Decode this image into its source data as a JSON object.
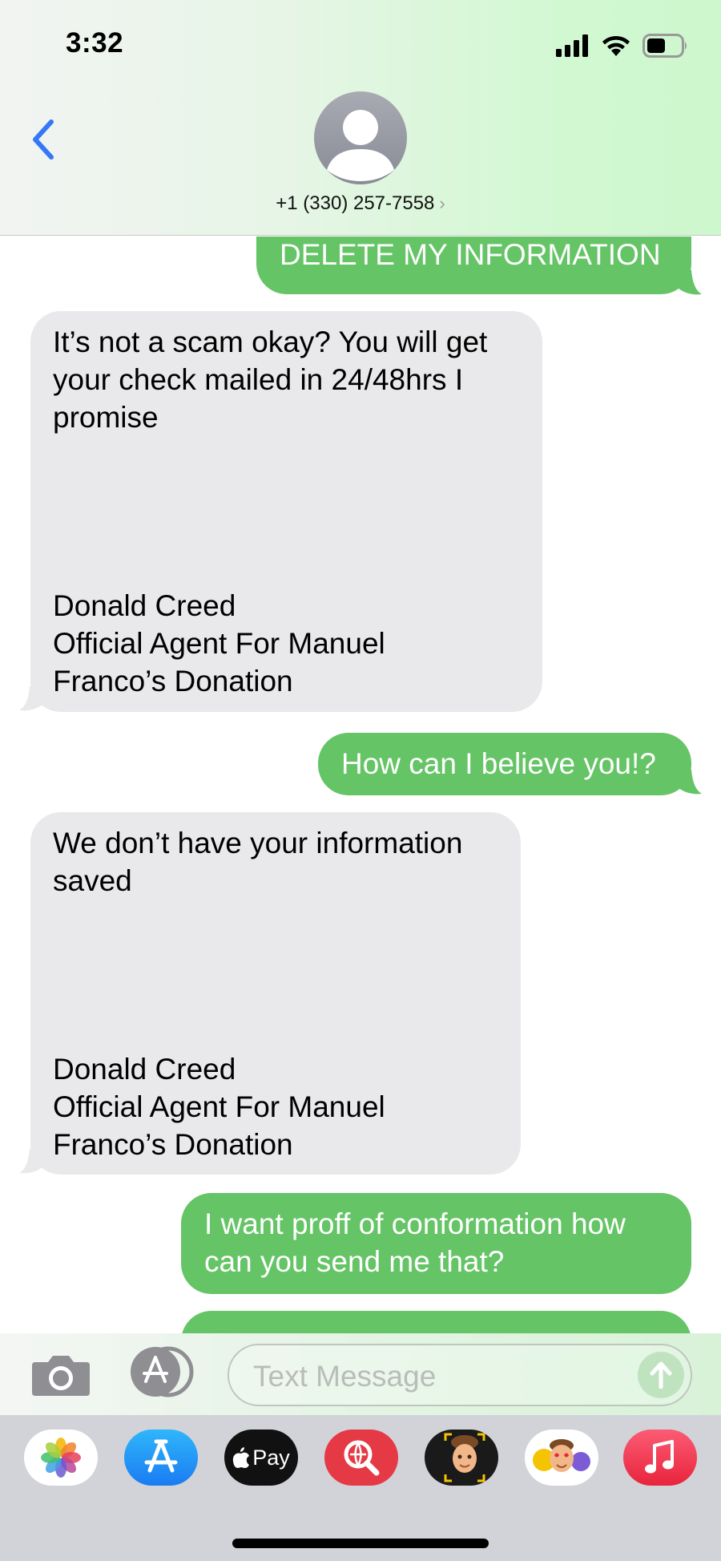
{
  "status_bar": {
    "time": "3:32"
  },
  "header": {
    "contact": "+1 (330) 257-7558",
    "chevron": "›"
  },
  "messages": [
    {
      "direction": "outgoing",
      "text": "DELETE MY INFORMATION"
    },
    {
      "direction": "incoming",
      "lines": [
        "It’s not a scam okay? You will get",
        "your check mailed in 24/48hrs I",
        "promise",
        "",
        "",
        "",
        "",
        "Donald Creed",
        "Official Agent For Manuel",
        "Franco’s Donation"
      ]
    },
    {
      "direction": "outgoing",
      "text": "How can I believe you!?"
    },
    {
      "direction": "incoming",
      "lines": [
        "We don’t have your information",
        "saved",
        "",
        "",
        "",
        "",
        "Donald Creed",
        "Official Agent For Manuel",
        "Franco’s Donation"
      ]
    },
    {
      "direction": "outgoing",
      "lines": [
        "I want proff of conformation how",
        "can you send me that?"
      ]
    }
  ],
  "input": {
    "placeholder": "Text Message"
  },
  "apps": [
    {
      "icon": "photos-icon"
    },
    {
      "icon": "app-store-icon"
    },
    {
      "icon": "apple-pay-icon",
      "label": "Pay"
    },
    {
      "icon": "web-search-icon"
    },
    {
      "icon": "memoji-icon"
    },
    {
      "icon": "memoji-stickers-icon"
    },
    {
      "icon": "music-icon"
    }
  ],
  "colors": {
    "outgoing_bubble": "#65c466",
    "incoming_bubble": "#e9e9eb",
    "link_blue": "#3478f6"
  }
}
